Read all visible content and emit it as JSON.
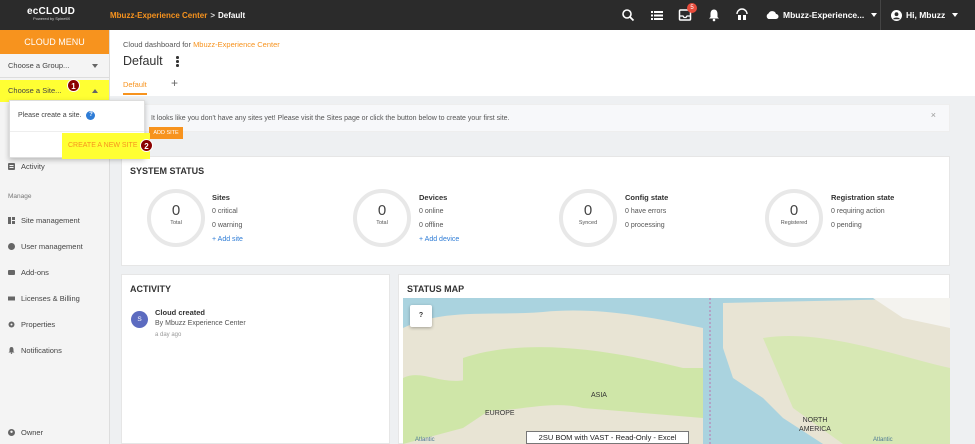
{
  "topbar": {
    "logo_main": "ecCLOUD",
    "logo_sub": "Powered by SpinetiX",
    "breadcrumb_org": "Mbuzz-Experience Center",
    "breadcrumb_sep": ">",
    "breadcrumb_page": "Default",
    "notification_count": "5",
    "cloud_name": "Mbuzz-Experience...",
    "user_greeting": "Hi, Mbuzz"
  },
  "sidebar": {
    "cloud_menu": "CLOUD MENU",
    "group_placeholder": "Choose a Group...",
    "site_placeholder": "Choose a Site...",
    "marker_1": "1",
    "activity": "Activity",
    "manage_header": "Manage",
    "items": [
      "Site management",
      "User management",
      "Add-ons",
      "Licenses & Billing",
      "Properties",
      "Notifications"
    ],
    "owner": "Owner"
  },
  "site_dropdown": {
    "message": "Please create a site.",
    "help": "?",
    "create_button": "CREATE A NEW SITE",
    "marker_2": "2"
  },
  "header": {
    "dashboard_for": "Cloud dashboard for",
    "dashboard_org": "Mbuzz-Experience Center",
    "title": "Default",
    "tab_default": "Default",
    "tab_add": "+"
  },
  "alert": {
    "text": "It looks like you don't have any sites yet! Please visit the Sites page or click the button below to create your first site.",
    "button": "ADD SITE",
    "close": "×"
  },
  "system_status": {
    "title": "SYSTEM STATUS",
    "blocks": [
      {
        "value": "0",
        "ring_label": "Total",
        "heading": "Sites",
        "line1": "0 critical",
        "line2": "0 warning",
        "link": "+ Add site"
      },
      {
        "value": "0",
        "ring_label": "Total",
        "heading": "Devices",
        "line1": "0 online",
        "line2": "0 offline",
        "link": "+ Add device"
      },
      {
        "value": "0",
        "ring_label": "Synced",
        "heading": "Config state",
        "line1": "0 have errors",
        "line2": "0 processing",
        "link": ""
      },
      {
        "value": "0",
        "ring_label": "Registered",
        "heading": "Registration state",
        "line1": "0 requiring action",
        "line2": "0 pending",
        "link": ""
      }
    ]
  },
  "activity": {
    "title": "ACTIVITY",
    "avatar": "S",
    "entry_title": "Cloud created",
    "entry_by": "By Mbuzz Experience Center",
    "entry_time": "a day ago"
  },
  "status_map": {
    "title": "STATUS MAP",
    "help": "?",
    "labels": [
      "ASIA",
      "EUROPE",
      "NORTH AMERICA"
    ],
    "ocean_left": "Atlantic",
    "ocean_right": "Atlantic"
  },
  "taskbar_tooltip": "2SU BOM with VAST - Read-Only - Excel",
  "colors": {
    "accent": "#f7931e",
    "highlight": "#ffff33",
    "marker": "#8b0000",
    "topbar": "#2b2b2b"
  }
}
